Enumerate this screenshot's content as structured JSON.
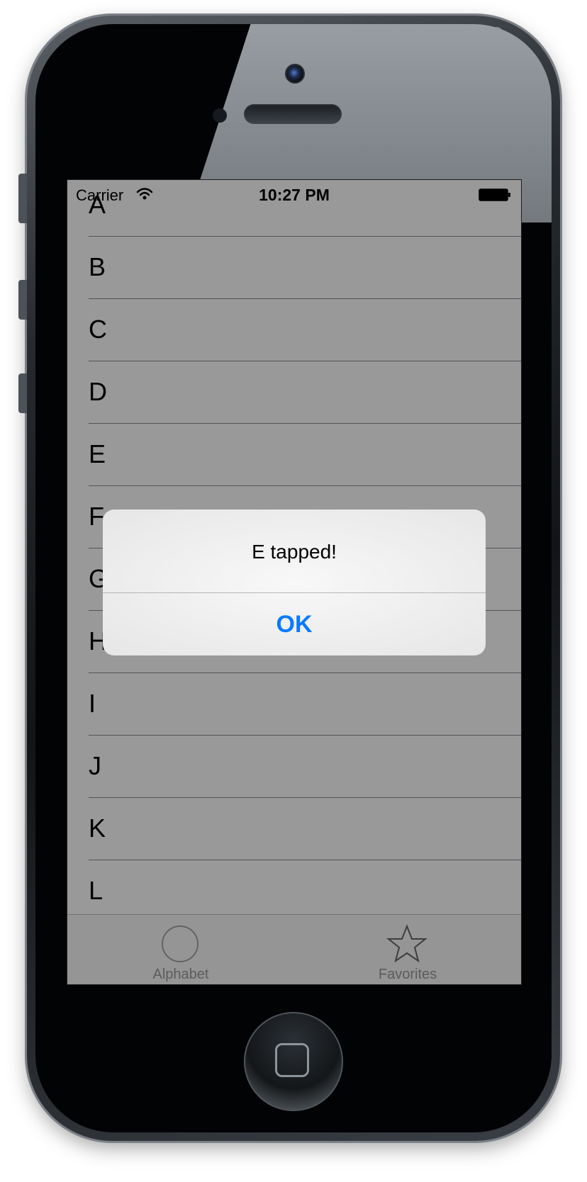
{
  "status_bar": {
    "carrier": "Carrier",
    "time": "10:27 PM",
    "wifi_icon": "wifi-icon",
    "battery_icon": "battery-icon"
  },
  "table": {
    "rows": [
      {
        "label": "A"
      },
      {
        "label": "B"
      },
      {
        "label": "C"
      },
      {
        "label": "D"
      },
      {
        "label": "E"
      },
      {
        "label": "F"
      },
      {
        "label": "G"
      },
      {
        "label": "H"
      },
      {
        "label": "I"
      },
      {
        "label": "J"
      },
      {
        "label": "K"
      },
      {
        "label": "L"
      }
    ]
  },
  "tab_bar": {
    "tabs": [
      {
        "label": "Alphabet",
        "icon": "alphabet-icon"
      },
      {
        "label": "Favorites",
        "icon": "star-icon"
      }
    ]
  },
  "alert": {
    "message": "E tapped!",
    "button": "OK"
  },
  "colors": {
    "accent": "#0a7aff",
    "overlay": "#000000"
  }
}
